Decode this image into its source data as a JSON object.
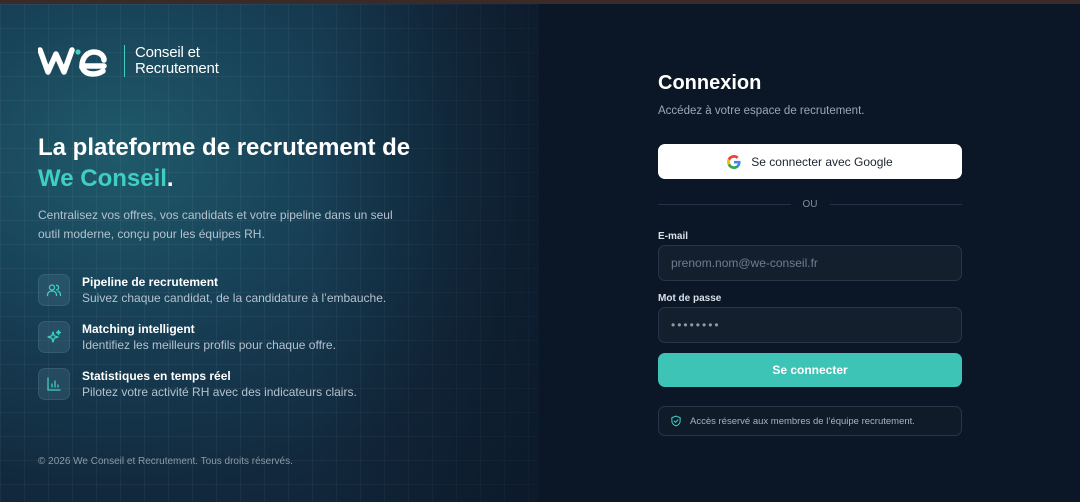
{
  "brand": {
    "name_line1": "Conseil et",
    "name_line2": "Recrutement"
  },
  "hero": {
    "headline_part1": "La plateforme de recrutement de ",
    "headline_brand": "We Conseil",
    "headline_end": ".",
    "subtext": "Centralisez vos offres, vos candidats et votre pipeline dans un seul outil moderne, conçu pour les équipes RH."
  },
  "features": [
    {
      "icon": "users-icon",
      "title": "Pipeline de recrutement",
      "desc": "Suivez chaque candidat, de la candidature à l’embauche."
    },
    {
      "icon": "sparkles-icon",
      "title": "Matching intelligent",
      "desc": "Identifiez les meilleurs profils pour chaque offre."
    },
    {
      "icon": "bar-chart-icon",
      "title": "Statistiques en temps réel",
      "desc": "Pilotez votre activité RH avec des indicateurs clairs."
    }
  ],
  "footer": {
    "copyright": "© 2026 We Conseil et Recrutement. Tous droits réservés."
  },
  "login": {
    "title": "Connexion",
    "caption": "Accédez à votre espace de recrutement.",
    "google_label": "Se connecter avec Google",
    "divider": "OU",
    "email_label": "E-mail",
    "email_placeholder": "prenom.nom@we-conseil.fr",
    "password_label": "Mot de passe",
    "password_value": "••••••••",
    "submit_label": "Se connecter",
    "notice": "Accès réservé aux membres de l’équipe recrutement."
  },
  "colors": {
    "accent": "#3ecfc0",
    "button": "#3ec3b7",
    "panel_bg": "#0b1626"
  }
}
